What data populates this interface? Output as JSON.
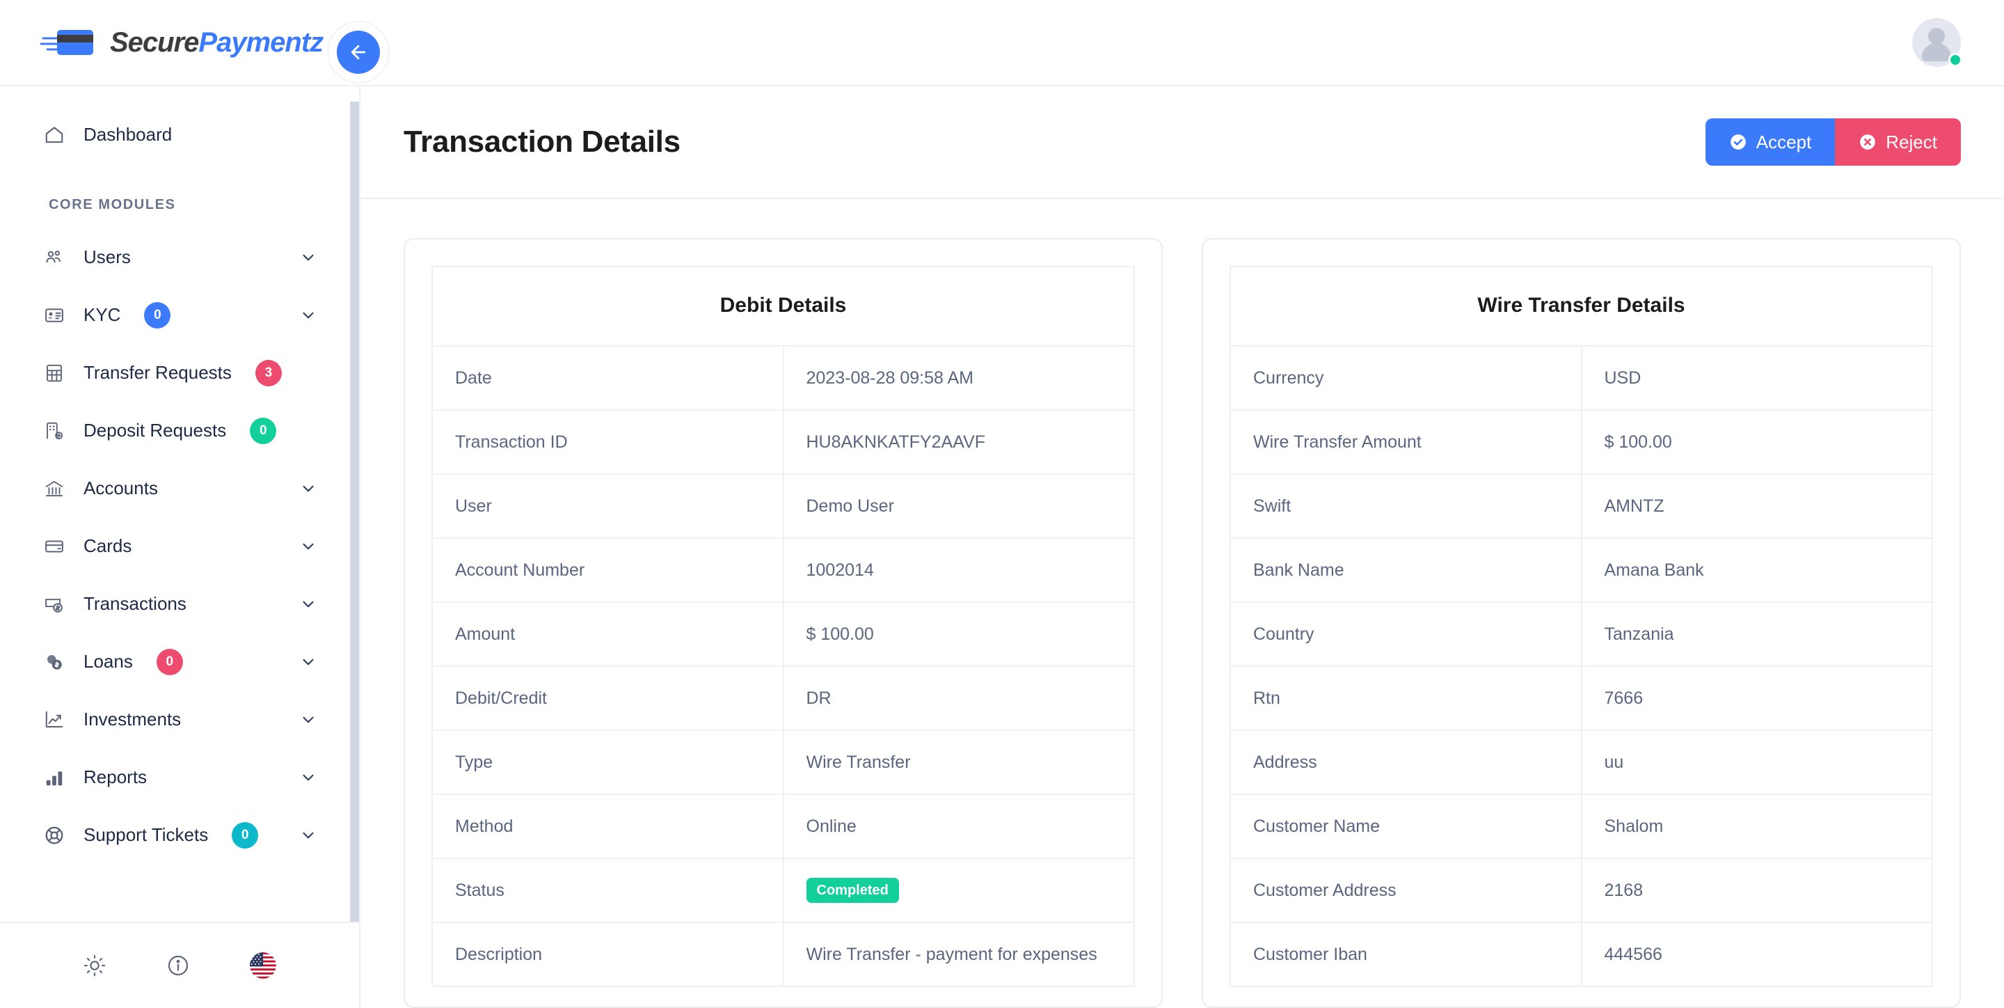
{
  "brand": {
    "name_part1": "Secure",
    "name_part2": "Paymentz",
    "logo_icon": "credit-card-icon"
  },
  "topbar": {
    "back_icon": "arrow-left-icon",
    "avatar_icon": "user-avatar-icon",
    "status_indicator_color": "#0ccf9c"
  },
  "sidebar": {
    "primary": [
      {
        "label": "Dashboard",
        "icon": "home-icon",
        "badge": null,
        "chevron": false
      }
    ],
    "section_label": "CORE MODULES",
    "items": [
      {
        "label": "Users",
        "icon": "users-icon",
        "badge": null,
        "badge_color": null,
        "chevron": true
      },
      {
        "label": "KYC",
        "icon": "id-card-icon",
        "badge": "0",
        "badge_color": "#3b7bfb",
        "chevron": true
      },
      {
        "label": "Transfer Requests",
        "icon": "grid-calculator-icon",
        "badge": "3",
        "badge_color": "#ed4c6e",
        "chevron": false
      },
      {
        "label": "Deposit Requests",
        "icon": "building-plus-icon",
        "badge": "0",
        "badge_color": "#13cf9a",
        "chevron": false
      },
      {
        "label": "Accounts",
        "icon": "bank-icon",
        "badge": null,
        "badge_color": null,
        "chevron": true
      },
      {
        "label": "Cards",
        "icon": "credit-card-icon",
        "badge": null,
        "badge_color": null,
        "chevron": true
      },
      {
        "label": "Transactions",
        "icon": "money-bill-icon",
        "badge": null,
        "badge_color": null,
        "chevron": true
      },
      {
        "label": "Loans",
        "icon": "coins-icon",
        "badge": "0",
        "badge_color": "#ed4c6e",
        "chevron": true
      },
      {
        "label": "Investments",
        "icon": "chart-line-up-icon",
        "badge": null,
        "badge_color": null,
        "chevron": true
      },
      {
        "label": "Reports",
        "icon": "bar-chart-icon",
        "badge": null,
        "badge_color": null,
        "chevron": true
      },
      {
        "label": "Support Tickets",
        "icon": "lifebuoy-icon",
        "badge": "0",
        "badge_color": "#0cb8c9",
        "chevron": true
      }
    ],
    "footer": [
      {
        "icon": "sun-icon"
      },
      {
        "icon": "info-circle-icon"
      },
      {
        "icon": "us-flag-icon"
      }
    ]
  },
  "page": {
    "title": "Transaction Details",
    "accept_label": "Accept",
    "accept_icon": "check-circle-icon",
    "accept_color": "#3b7bfb",
    "reject_label": "Reject",
    "reject_icon": "times-circle-icon",
    "reject_color": "#ed4c6e"
  },
  "debit_details": {
    "title": "Debit Details",
    "rows": [
      {
        "key": "Date",
        "value": "2023-08-28 09:58 AM"
      },
      {
        "key": "Transaction ID",
        "value": "HU8AKNKATFY2AAVF"
      },
      {
        "key": "User",
        "value": "Demo User"
      },
      {
        "key": "Account Number",
        "value": "1002014"
      },
      {
        "key": "Amount",
        "value": "$ 100.00"
      },
      {
        "key": "Debit/Credit",
        "value": "DR"
      },
      {
        "key": "Type",
        "value": "Wire Transfer"
      },
      {
        "key": "Method",
        "value": "Online"
      },
      {
        "key": "Status",
        "value": "Completed",
        "badge": true,
        "badge_color": "#13cf9a"
      },
      {
        "key": "Description",
        "value": "Wire Transfer - payment for expenses"
      }
    ]
  },
  "wire_transfer_details": {
    "title": "Wire Transfer Details",
    "rows": [
      {
        "key": "Currency",
        "value": "USD"
      },
      {
        "key": "Wire Transfer Amount",
        "value": "$ 100.00"
      },
      {
        "key": "Swift",
        "value": "AMNTZ"
      },
      {
        "key": "Bank Name",
        "value": "Amana Bank"
      },
      {
        "key": "Country",
        "value": "Tanzania"
      },
      {
        "key": "Rtn",
        "value": "7666"
      },
      {
        "key": "Address",
        "value": "uu"
      },
      {
        "key": "Customer Name",
        "value": "Shalom"
      },
      {
        "key": "Customer Address",
        "value": "2168"
      },
      {
        "key": "Customer Iban",
        "value": "444566"
      }
    ]
  }
}
